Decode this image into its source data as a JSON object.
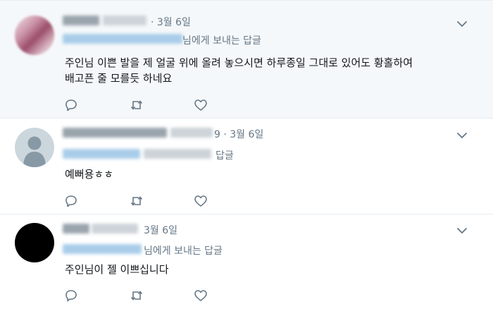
{
  "tweets": [
    {
      "date": "· 3월 6일",
      "reply_suffix": "님에게 보내는 답글",
      "text_line1": "주인님 이쁜 발을 제 얼굴 위에 올려 놓으시면  하루종일 그대로 있어도 황홀하여",
      "text_line2": "배고픈 줄 모를듯 하네요"
    },
    {
      "date": "9 · 3월 6일",
      "reply_suffix": "답글",
      "text_line1": "예뻐용ㅎㅎ"
    },
    {
      "date": "3월 6일",
      "reply_suffix": "님에게 보내는 답글",
      "text_line1": "주인님이 젤 이쁘십니다"
    }
  ],
  "icons": {
    "reply": "reply-icon",
    "retweet": "retweet-icon",
    "like": "heart-icon",
    "menu": "chevron-down-icon",
    "default_avatar": "default-profile-icon"
  },
  "colors": {
    "selected_background": "#f5f8fa",
    "secondary_text": "#657786",
    "icon": "#657786",
    "divider": "#e6ecf0"
  }
}
